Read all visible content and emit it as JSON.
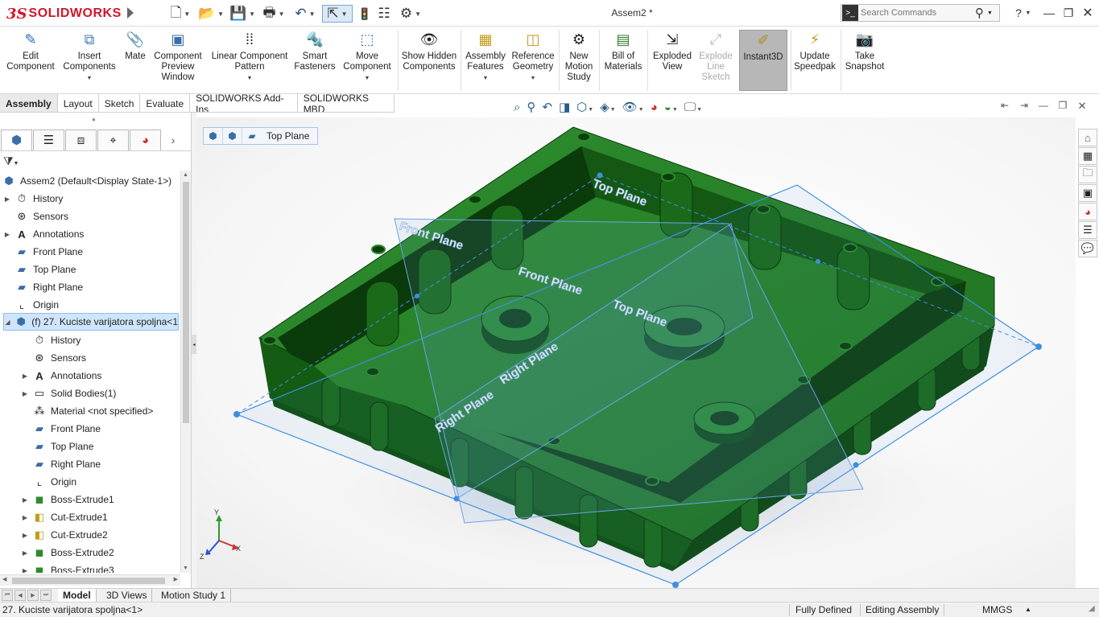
{
  "app": {
    "logo_mark": "3S",
    "logo_text": "SOLIDWORKS",
    "document_title": "Assem2 *"
  },
  "search": {
    "placeholder": "Search Commands"
  },
  "ribbon": {
    "edit_component": "Edit Component",
    "insert_components": "Insert Components",
    "mate": "Mate",
    "component_preview_window": "Component Preview Window",
    "linear_component_pattern": "Linear Component Pattern",
    "smart_fasteners": "Smart Fasteners",
    "move_component": "Move Component",
    "show_hidden_components": "Show Hidden Components",
    "assembly_features": "Assembly Features",
    "reference_geometry": "Reference Geometry",
    "new_motion_study": "New Motion Study",
    "bill_of_materials": "Bill of Materials",
    "exploded_view": "Exploded View",
    "explode_line_sketch": "Explode Line Sketch",
    "instant3d": "Instant3D",
    "update_speedpak": "Update Speedpak",
    "take_snapshot": "Take Snapshot"
  },
  "cm_tabs": [
    "Assembly",
    "Layout",
    "Sketch",
    "Evaluate",
    "SOLIDWORKS Add-Ins",
    "SOLIDWORKS MBD"
  ],
  "breadcrumb": {
    "label": "Top Plane"
  },
  "tree": {
    "root": "Assem2  (Default<Display State-1>)",
    "top_items": [
      "History",
      "Sensors",
      "Annotations",
      "Front Plane",
      "Top Plane",
      "Right Plane",
      "Origin"
    ],
    "component": "(f) 27. Kuciste varijatora spoljna<1",
    "comp_items": [
      "History",
      "Sensors",
      "Annotations",
      "Solid Bodies(1)",
      "Material <not specified>",
      "Front Plane",
      "Top Plane",
      "Right Plane",
      "Origin",
      "Boss-Extrude1",
      "Cut-Extrude1",
      "Cut-Extrude2",
      "Boss-Extrude2",
      "Boss-Extrude3"
    ]
  },
  "planes": {
    "top": "Top Plane",
    "front": "Front Plane",
    "right": "Right Plane"
  },
  "triad": {
    "x": "X",
    "y": "Y",
    "z": "Z"
  },
  "bottom_tabs": [
    "Model",
    "3D Views",
    "Motion Study 1"
  ],
  "status": {
    "left": "27. Kuciste varijatora spoljna<1>",
    "defined": "Fully Defined",
    "mode": "Editing Assembly",
    "units": "MMGS"
  },
  "colors": {
    "model_green": "#1e7a1e",
    "plane_blue": "#3f8fe0",
    "selection": "#cfe5fb",
    "logo_red": "#d3152a"
  }
}
